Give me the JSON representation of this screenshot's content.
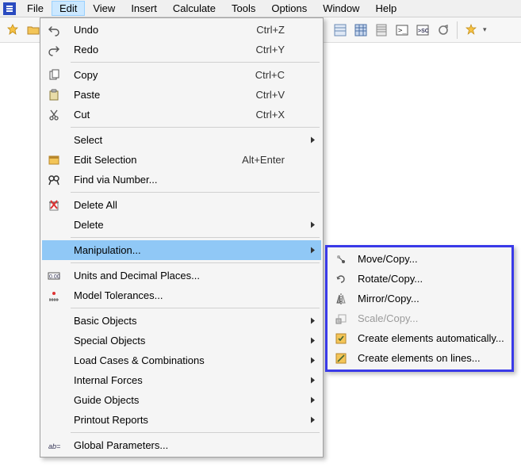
{
  "menubar": {
    "items": [
      "File",
      "Edit",
      "View",
      "Insert",
      "Calculate",
      "Tools",
      "Options",
      "Window",
      "Help"
    ],
    "open_index": 1
  },
  "dropdown": {
    "groups": [
      [
        {
          "icon": "undo-icon",
          "label": "Undo",
          "shortcut": "Ctrl+Z"
        },
        {
          "icon": "redo-icon",
          "label": "Redo",
          "shortcut": "Ctrl+Y"
        }
      ],
      [
        {
          "icon": "copy-icon",
          "label": "Copy",
          "shortcut": "Ctrl+C"
        },
        {
          "icon": "paste-icon",
          "label": "Paste",
          "shortcut": "Ctrl+V"
        },
        {
          "icon": "cut-icon",
          "label": "Cut",
          "shortcut": "Ctrl+X"
        }
      ],
      [
        {
          "icon": "",
          "label": "Select",
          "shortcut": "",
          "submenu": true
        },
        {
          "icon": "edit-selection-icon",
          "label": "Edit Selection",
          "shortcut": "Alt+Enter"
        },
        {
          "icon": "find-icon",
          "label": "Find via Number...",
          "shortcut": ""
        }
      ],
      [
        {
          "icon": "delete-all-icon",
          "label": "Delete All",
          "shortcut": ""
        },
        {
          "icon": "",
          "label": "Delete",
          "shortcut": "",
          "submenu": true
        }
      ],
      [
        {
          "icon": "",
          "label": "Manipulation...",
          "shortcut": "",
          "submenu": true,
          "highlight": true
        }
      ],
      [
        {
          "icon": "units-icon",
          "label": "Units and Decimal Places...",
          "shortcut": ""
        },
        {
          "icon": "tolerances-icon",
          "label": "Model Tolerances...",
          "shortcut": ""
        }
      ],
      [
        {
          "icon": "",
          "label": "Basic Objects",
          "shortcut": "",
          "submenu": true
        },
        {
          "icon": "",
          "label": "Special Objects",
          "shortcut": "",
          "submenu": true
        },
        {
          "icon": "",
          "label": "Load Cases & Combinations",
          "shortcut": "",
          "submenu": true
        },
        {
          "icon": "",
          "label": "Internal Forces",
          "shortcut": "",
          "submenu": true
        },
        {
          "icon": "",
          "label": "Guide Objects",
          "shortcut": "",
          "submenu": true
        },
        {
          "icon": "",
          "label": "Printout Reports",
          "shortcut": "",
          "submenu": true
        }
      ],
      [
        {
          "icon": "global-params-icon",
          "label": "Global Parameters...",
          "shortcut": ""
        }
      ]
    ]
  },
  "submenu": {
    "items": [
      {
        "icon": "move-copy-icon",
        "label": "Move/Copy...",
        "disabled": false
      },
      {
        "icon": "rotate-copy-icon",
        "label": "Rotate/Copy...",
        "disabled": false
      },
      {
        "icon": "mirror-copy-icon",
        "label": "Mirror/Copy...",
        "disabled": false
      },
      {
        "icon": "scale-copy-icon",
        "label": "Scale/Copy...",
        "disabled": true
      },
      {
        "icon": "create-auto-icon",
        "label": "Create elements automatically...",
        "disabled": false
      },
      {
        "icon": "create-lines-icon",
        "label": "Create elements on lines...",
        "disabled": false
      }
    ]
  },
  "toolbar": {
    "buttons_left": [
      "new-icon",
      "open-icon",
      "save-icon"
    ],
    "buttons_right": [
      "grid1-icon",
      "grid2-icon",
      "panel-icon",
      "terminal-icon",
      "sc-icon",
      "refresh-icon",
      "star-icon"
    ]
  }
}
